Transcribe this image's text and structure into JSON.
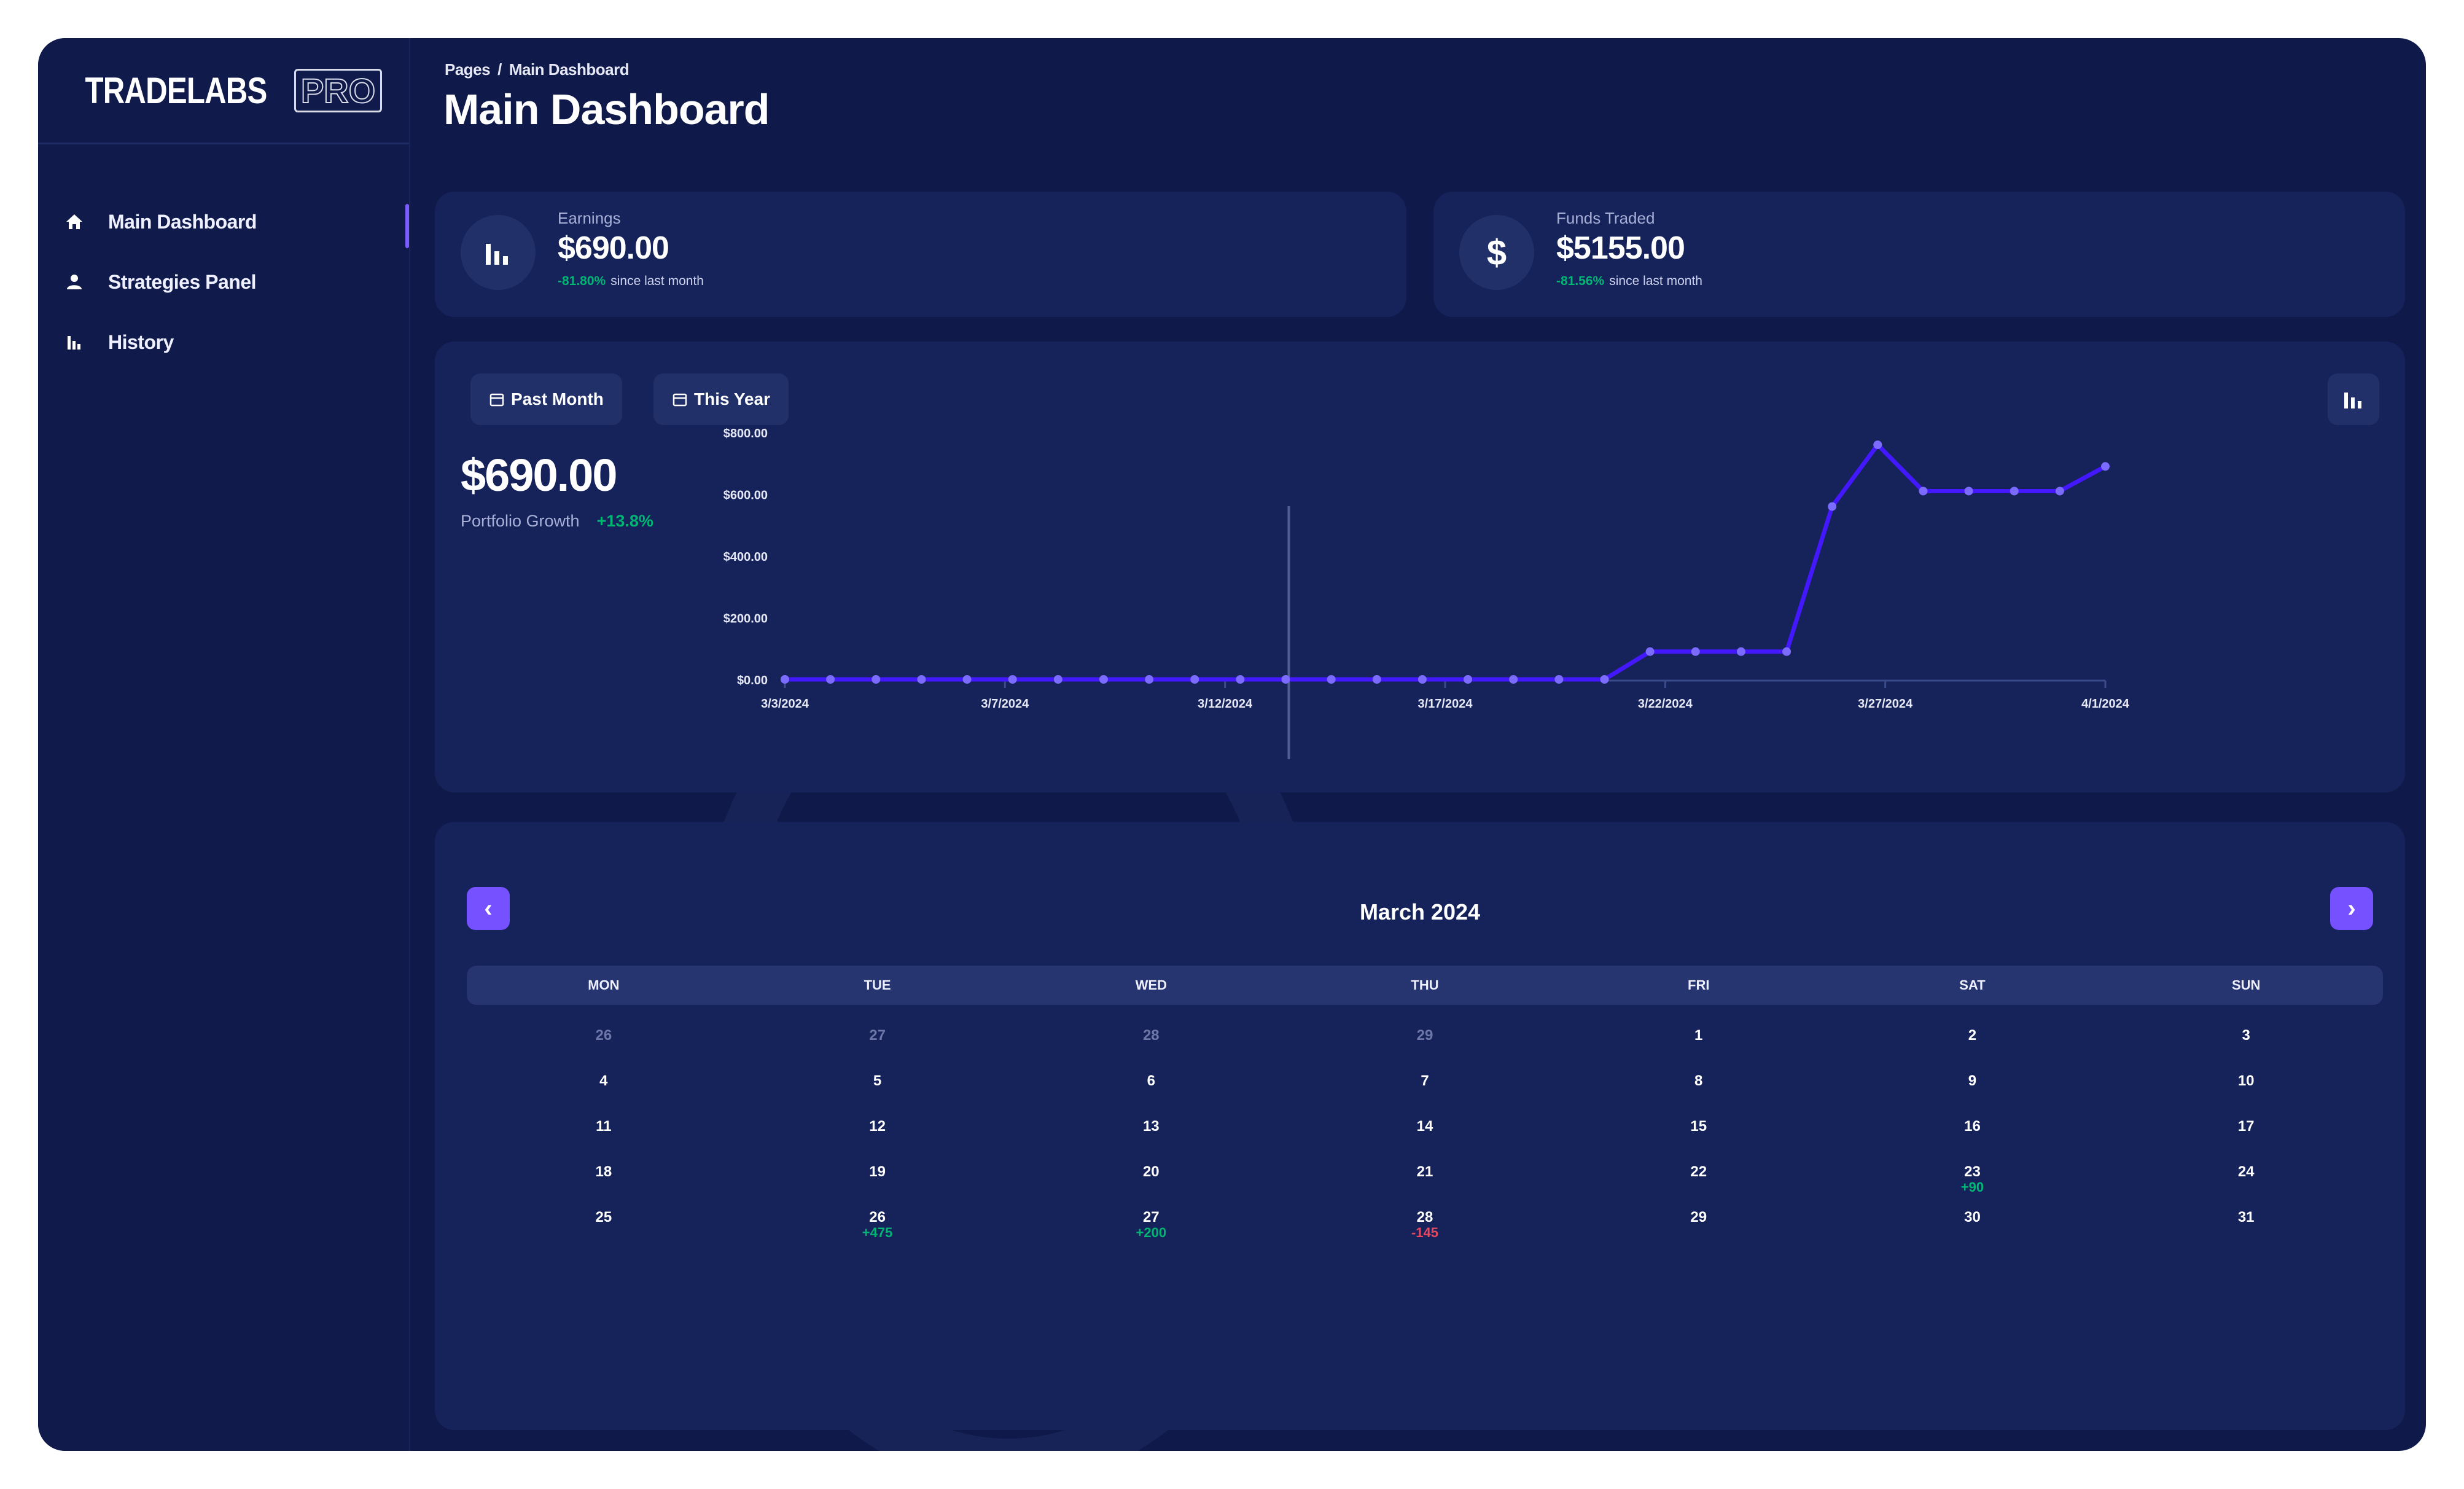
{
  "app": {
    "logo_text": "TRADELABS",
    "logo_badge": "PRO"
  },
  "sidebar": {
    "items": [
      {
        "label": "Main Dashboard",
        "icon": "home-icon",
        "active": true
      },
      {
        "label": "Strategies Panel",
        "icon": "user-icon",
        "active": false
      },
      {
        "label": "History",
        "icon": "bar-chart-icon",
        "active": false
      }
    ]
  },
  "header": {
    "breadcrumb_root": "Pages",
    "breadcrumb_sep": "/",
    "breadcrumb_current": "Main Dashboard",
    "title": "Main Dashboard"
  },
  "stats": [
    {
      "label": "Earnings",
      "value": "$690.00",
      "change": "-81.80%",
      "change_note": "since last month",
      "icon": "bar-chart-icon"
    },
    {
      "label": "Funds Traded",
      "value": "$5155.00",
      "change": "-81.56%",
      "change_note": "since last month",
      "icon": "dollar-icon"
    }
  ],
  "portfolio": {
    "filters": [
      "Past Month",
      "This Year"
    ],
    "value": "$690.00",
    "label": "Portfolio Growth",
    "change": "+13.8%"
  },
  "chart_data": {
    "type": "line",
    "title": "",
    "xlabel": "",
    "ylabel": "",
    "x_ticks": [
      "3/3/2024",
      "3/7/2024",
      "3/12/2024",
      "3/17/2024",
      "3/22/2024",
      "3/27/2024",
      "4/1/2024"
    ],
    "y_ticks": [
      "$0.00",
      "$200.00",
      "$400.00",
      "$600.00",
      "$800.00"
    ],
    "ylim": [
      0,
      800
    ],
    "series": [
      {
        "values": [
          0,
          0,
          0,
          0,
          0,
          0,
          0,
          0,
          0,
          0,
          0,
          0,
          0,
          0,
          0,
          0,
          0,
          0,
          0,
          90,
          90,
          90,
          90,
          560,
          760,
          610,
          610,
          610,
          610,
          690
        ],
        "color": "#4318ff"
      }
    ],
    "grid": false
  },
  "calendar": {
    "month_label": "March 2024",
    "prev_symbol": "‹",
    "next_symbol": "›",
    "weekdays": [
      "MON",
      "TUE",
      "WED",
      "THU",
      "FRI",
      "SAT",
      "SUN"
    ],
    "weeks": [
      [
        {
          "d": "26",
          "m": true
        },
        {
          "d": "27",
          "m": true
        },
        {
          "d": "28",
          "m": true
        },
        {
          "d": "29",
          "m": true
        },
        {
          "d": "1"
        },
        {
          "d": "2"
        },
        {
          "d": "3"
        }
      ],
      [
        {
          "d": "4"
        },
        {
          "d": "5"
        },
        {
          "d": "6"
        },
        {
          "d": "7"
        },
        {
          "d": "8"
        },
        {
          "d": "9"
        },
        {
          "d": "10"
        }
      ],
      [
        {
          "d": "11"
        },
        {
          "d": "12"
        },
        {
          "d": "13"
        },
        {
          "d": "14"
        },
        {
          "d": "15"
        },
        {
          "d": "16"
        },
        {
          "d": "17"
        }
      ],
      [
        {
          "d": "18"
        },
        {
          "d": "19"
        },
        {
          "d": "20"
        },
        {
          "d": "21"
        },
        {
          "d": "22"
        },
        {
          "d": "23",
          "p": "+90",
          "s": "pos"
        },
        {
          "d": "24"
        }
      ],
      [
        {
          "d": "25"
        },
        {
          "d": "26",
          "p": "+475",
          "s": "pos"
        },
        {
          "d": "27",
          "p": "+200",
          "s": "pos"
        },
        {
          "d": "28",
          "p": "-145",
          "s": "neg"
        },
        {
          "d": "29"
        },
        {
          "d": "30"
        },
        {
          "d": "31"
        }
      ]
    ]
  },
  "colors": {
    "background": "#0f1a4a",
    "card": "#16235a",
    "accent": "#7551ff",
    "line": "#4318ff",
    "positive": "#01b574",
    "negative": "#e8475f"
  }
}
